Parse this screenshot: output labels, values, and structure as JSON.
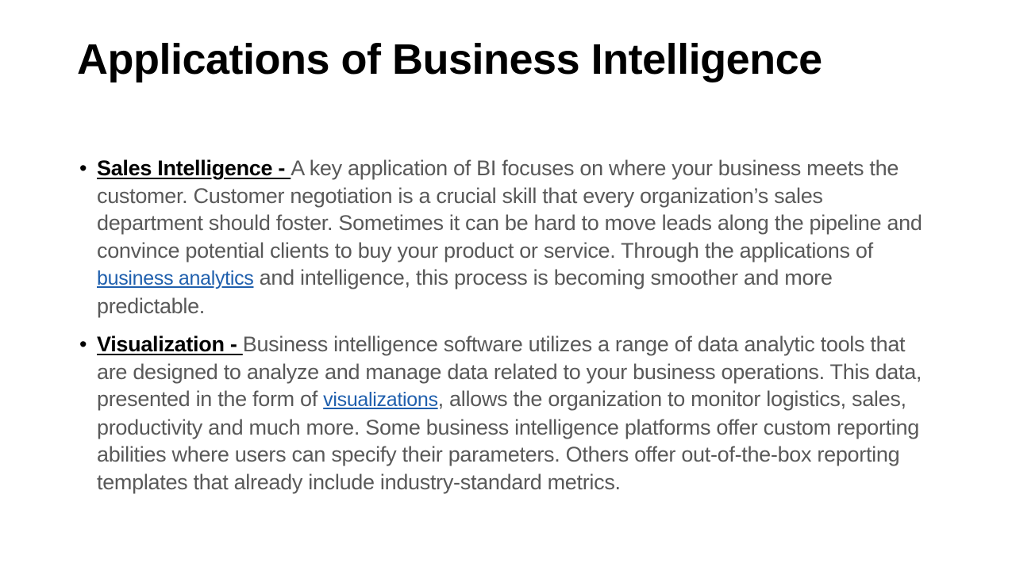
{
  "slide": {
    "title": "Applications of Business Intelligence",
    "bullet_glyph": "•",
    "bullets": [
      {
        "term": "Sales Intelligence - ",
        "text_before_link": "A key application of BI focuses on where your business meets the customer. Customer negotiation is a crucial skill that every organization’s sales department should foster. Sometimes it can be hard to move leads along the pipeline and convince potential clients to buy your product or service. Through the applications of ",
        "link": "business analytics",
        "text_after_link": " and intelligence, this process is becoming smoother and more predictable."
      },
      {
        "term": "Visualization - ",
        "text_before_link": "Business intelligence software utilizes a range of data analytic tools that are designed to analyze and manage data related to your business operations. This data, presented in the form of ",
        "link": "visualizations",
        "text_after_link": ", allows the organization to monitor logistics, sales, productivity and much more. Some business intelligence platforms offer custom reporting abilities where users can specify their parameters. Others offer out-of-the-box reporting templates that already include industry-standard metrics."
      }
    ]
  },
  "colors": {
    "title": "#000000",
    "body_text": "#595959",
    "term": "#000000",
    "link": "#1f5fad",
    "background": "#ffffff"
  }
}
